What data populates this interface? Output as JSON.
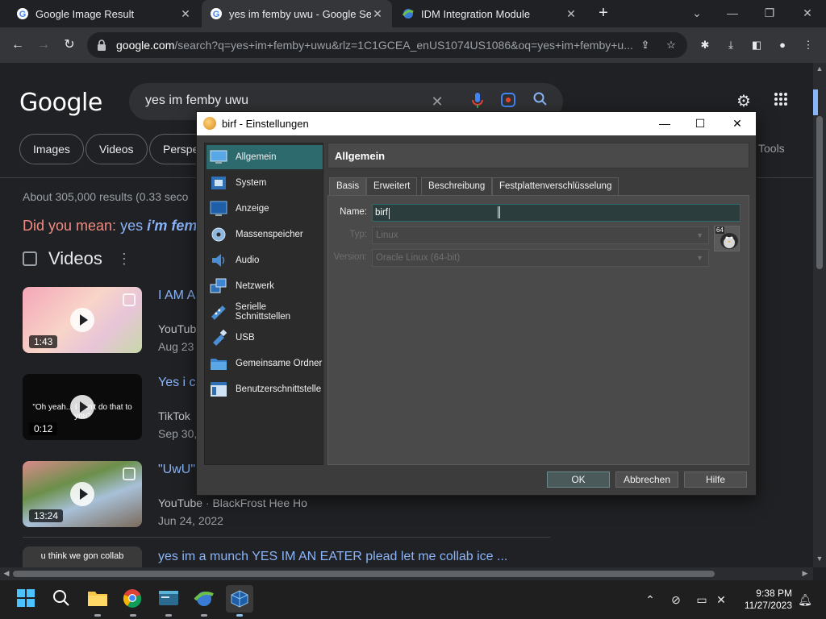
{
  "browser": {
    "tabs": [
      {
        "title": "Google Image Result",
        "active": false
      },
      {
        "title": "yes im femby uwu - Google Sea",
        "active": true
      },
      {
        "title": "IDM Integration Module",
        "active": false
      }
    ],
    "url_domain": "google.com",
    "url_rest": "/search?q=yes+im+femby+uwu&rlz=1C1GCEA_enUS1074US1086&oq=yes+im+femby+u..."
  },
  "google": {
    "logo": "Google",
    "query": "yes im femby uwu",
    "chips": [
      "Images",
      "Videos",
      "Perspe"
    ],
    "tools": "Tools",
    "stats": "About 305,000 results (0.33 seco",
    "did_you_mean_label": "Did you mean:",
    "did_you_mean_q1": "yes",
    "did_you_mean_q2": "i'm femi",
    "videos_heading": "Videos",
    "videos": [
      {
        "title": "I AM A",
        "source": "YouTub",
        "date": "Aug 23",
        "duration": "1:43",
        "caption": ""
      },
      {
        "title": "Yes i c",
        "source": "TikTok",
        "date": "Sep 30,",
        "duration": "0:12",
        "caption": "\"Oh yeah... I can't do that to you\""
      },
      {
        "title": "\"UwU\"",
        "source": "YouTube",
        "source_sep": " · ",
        "channel": "BlackFrost Hee Ho",
        "date": "Jun 24, 2022",
        "duration": "13:24",
        "caption": ""
      },
      {
        "title": "yes im a munch YES IM AN EATER plead let me collab ice ...",
        "caption": "u think we gon collab"
      }
    ]
  },
  "dialog": {
    "title": "birf - Einstellungen",
    "sidebar": [
      "Allgemein",
      "System",
      "Anzeige",
      "Massenspeicher",
      "Audio",
      "Netzwerk",
      "Serielle Schnittstellen",
      "USB",
      "Gemeinsame Ordner",
      "Benutzerschnittstelle"
    ],
    "selected_section": "Allgemein",
    "panel_title": "Allgemein",
    "subtabs": [
      "Basis",
      "Erweitert",
      "Beschreibung",
      "Festplattenverschlüsselung"
    ],
    "name_label": "Name:",
    "name_value": "birf",
    "type_label": "Typ:",
    "type_value": "Linux",
    "version_label": "Version:",
    "version_value": "Oracle Linux (64-bit)",
    "os_badge": "64",
    "ok": "OK",
    "cancel": "Abbrechen",
    "help": "Hilfe"
  },
  "taskbar": {
    "time": "9:38 PM",
    "date": "11/27/2023"
  },
  "colors": {
    "google_link": "#8ab4f8",
    "did_you_mean": "#f28b82",
    "vbox_selection": "#2d6a6e",
    "page_bg": "#202124"
  }
}
